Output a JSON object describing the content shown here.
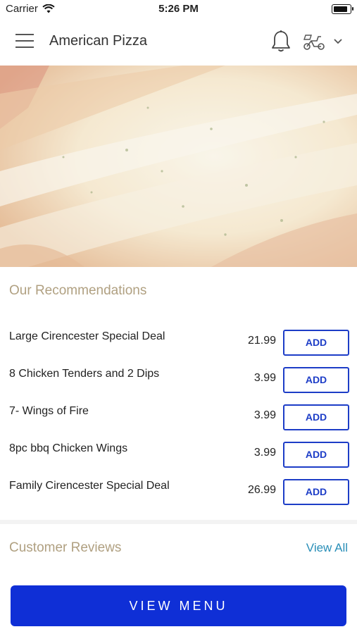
{
  "status_bar": {
    "carrier": "Carrier",
    "time": "5:26 PM"
  },
  "header": {
    "title": "American Pizza",
    "icons": [
      "hamburger-menu-icon",
      "bell-icon",
      "scooter-icon",
      "chevron-down-icon"
    ]
  },
  "recommendations": {
    "title": "Our Recommendations",
    "items": [
      {
        "name": "Large Cirencester Special Deal",
        "price": "21.99",
        "button": "ADD"
      },
      {
        "name": "8 Chicken Tenders and 2 Dips",
        "price": "3.99",
        "button": "ADD"
      },
      {
        "name": "7- Wings of Fire",
        "price": "3.99",
        "button": "ADD"
      },
      {
        "name": "8pc bbq Chicken Wings",
        "price": "3.99",
        "button": "ADD"
      },
      {
        "name": "Family Cirencester Special Deal",
        "price": "26.99",
        "button": "ADD"
      }
    ]
  },
  "reviews": {
    "title": "Customer Reviews",
    "view_all": "View All"
  },
  "footer": {
    "button": "VIEW MENU"
  },
  "colors": {
    "accent_blue": "#1d3dc7",
    "section_title": "#b0a081",
    "link": "#2a8fb8"
  }
}
